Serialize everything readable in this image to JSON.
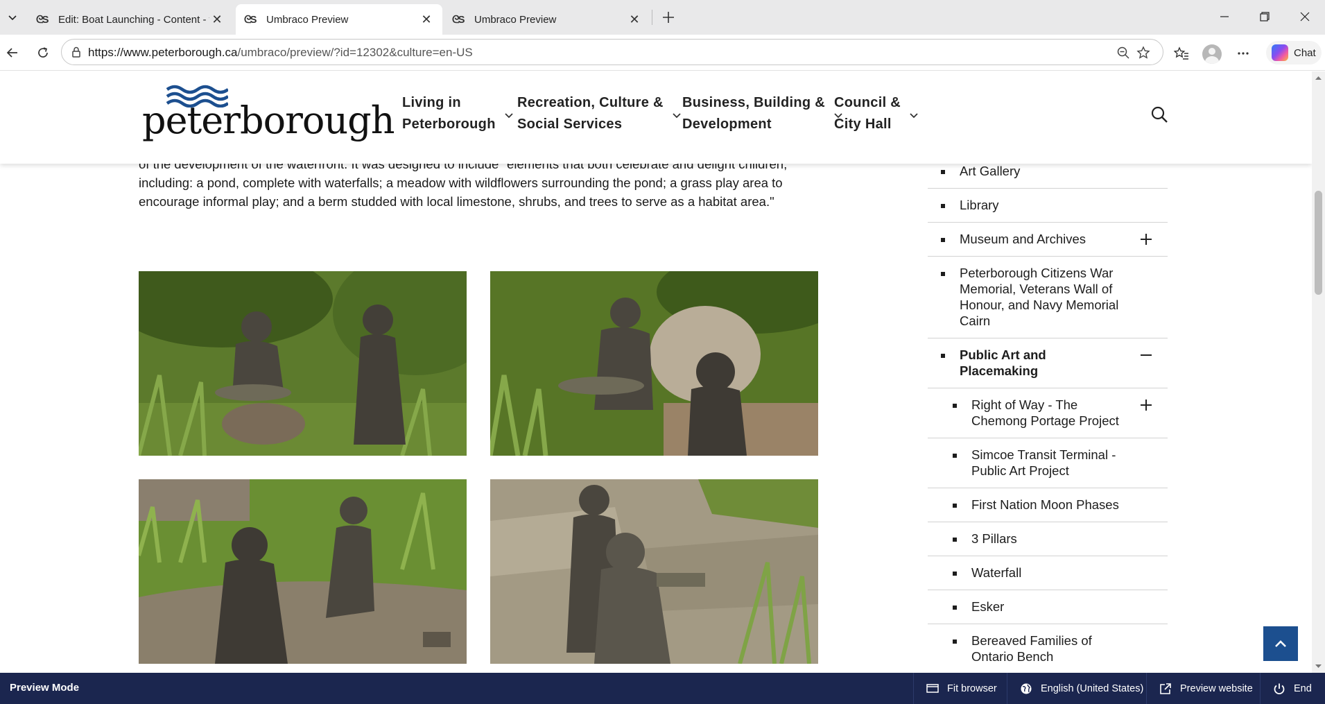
{
  "browser": {
    "tabs": [
      {
        "title": "Edit: Boat Launching - Content - www.peterborough.ca",
        "active": false
      },
      {
        "title": "Umbraco Preview",
        "active": true
      },
      {
        "title": "Umbraco Preview",
        "active": false
      }
    ],
    "url_host": "https://www.peterborough.ca",
    "url_path": "/umbraco/preview/?id=12302&culture=en-US",
    "chat_label": "Chat"
  },
  "site": {
    "logo_text": "peterborough",
    "nav": [
      {
        "line1": "Living in",
        "line2": "Peterborough"
      },
      {
        "line1": "Recreation, Culture &",
        "line2": "Social Services"
      },
      {
        "line1": "Business, Building &",
        "line2": "Development"
      },
      {
        "line1": "Council &",
        "line2": "City Hall"
      }
    ],
    "brand_color": "#1c4f8f"
  },
  "content": {
    "intro_text": "of the development of the waterfront. It was designed to include \"elements that both celebrate and delight children, including: a pond, complete with waterfalls; a meadow with wildflowers surrounding the pond; a grass play area to encourage informal play; and a berm studded with local limestone, shrubs, and trees to serve as a habitat area.\""
  },
  "sidebar": {
    "items": [
      {
        "label": "Art Gallery",
        "level": 1,
        "toggle": "none"
      },
      {
        "label": "Library",
        "level": 1,
        "toggle": "none"
      },
      {
        "label": "Museum and Archives",
        "level": 1,
        "toggle": "expand"
      },
      {
        "label": "Peterborough Citizens War Memorial, Veterans Wall of Honour, and Navy Memorial Cairn",
        "level": 1,
        "toggle": "none"
      },
      {
        "label": "Public Art and Placemaking",
        "level": 1,
        "toggle": "collapse",
        "current": true
      },
      {
        "label": "Right of Way - The Chemong Portage Project",
        "level": 2,
        "toggle": "expand"
      },
      {
        "label": "Simcoe Transit Terminal - Public Art Project",
        "level": 2,
        "toggle": "none"
      },
      {
        "label": "First Nation Moon Phases",
        "level": 2,
        "toggle": "none"
      },
      {
        "label": "3 Pillars",
        "level": 2,
        "toggle": "none"
      },
      {
        "label": "Waterfall",
        "level": 2,
        "toggle": "none"
      },
      {
        "label": "Esker",
        "level": 2,
        "toggle": "none"
      },
      {
        "label": "Bereaved Families of Ontario Bench",
        "level": 2,
        "toggle": "none"
      }
    ]
  },
  "preview_bar": {
    "title": "Preview Mode",
    "fit_browser": "Fit browser",
    "language": "English (United States)",
    "preview_website": "Preview website",
    "end": "End"
  }
}
